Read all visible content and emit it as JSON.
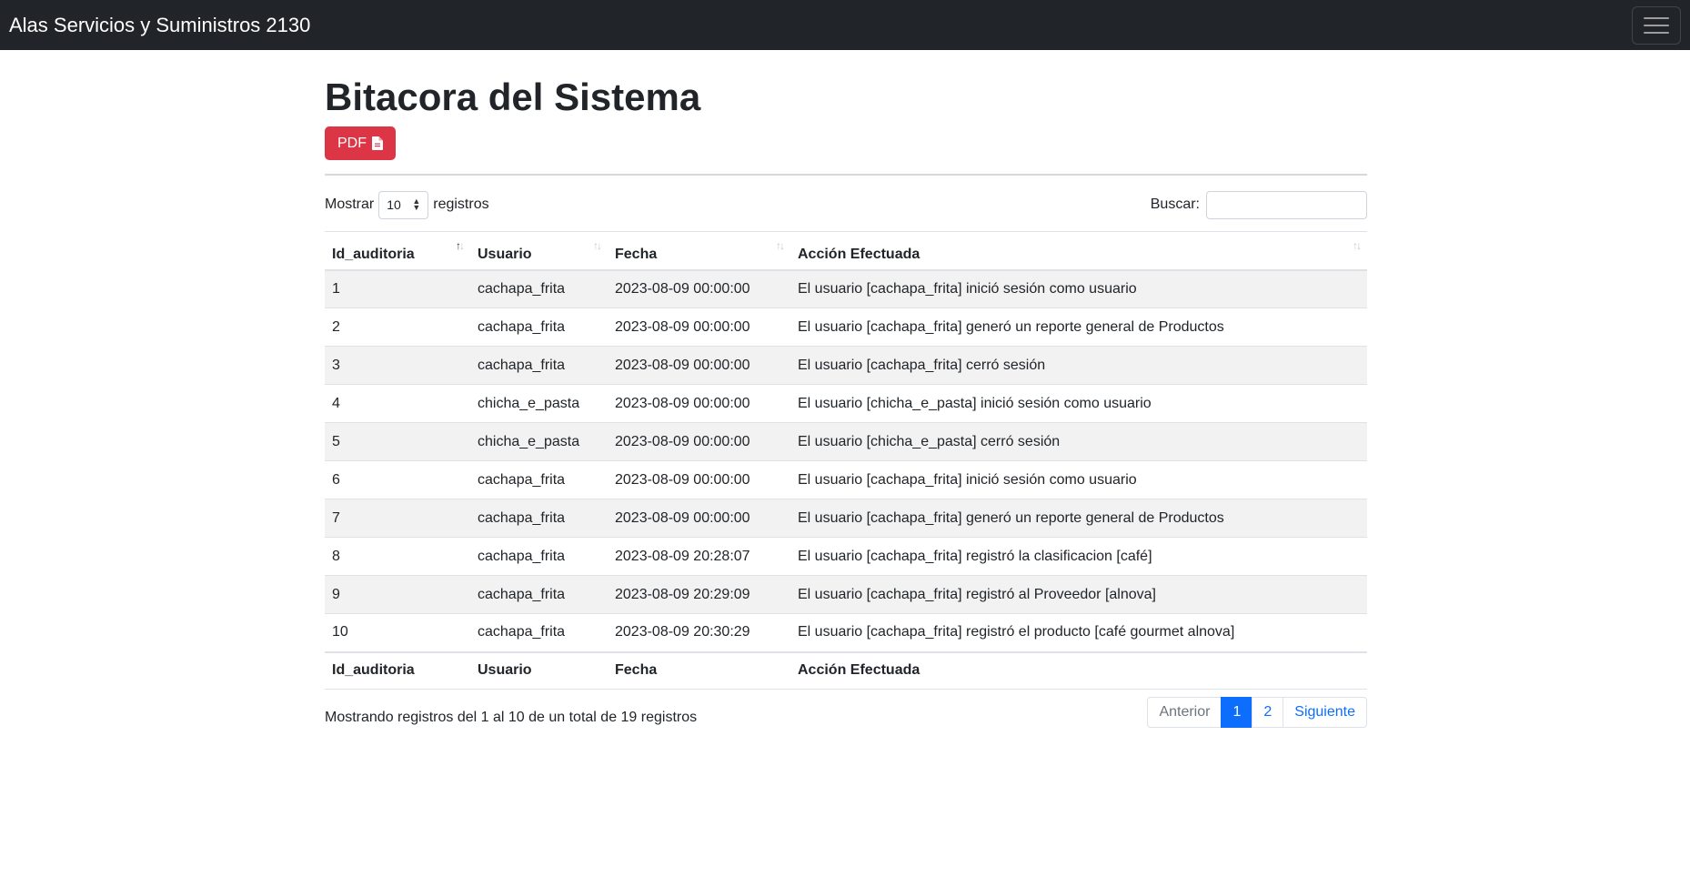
{
  "navbar": {
    "brand": "Alas Servicios y Suministros 2130",
    "toggler_icon": "hamburger-menu-icon"
  },
  "page": {
    "title": "Bitacora del Sistema",
    "pdf_button": "PDF",
    "pdf_icon": "file-icon"
  },
  "controls": {
    "show_label": "Mostrar",
    "length_value": "10",
    "records_label": "registros",
    "search_label": "Buscar:",
    "search_value": ""
  },
  "table": {
    "columns": [
      "Id_auditoria",
      "Usuario",
      "Fecha",
      "Acción Efectuada"
    ],
    "rows": [
      [
        "1",
        "cachapa_frita",
        "2023-08-09 00:00:00",
        "El usuario [cachapa_frita] inició sesión como usuario"
      ],
      [
        "2",
        "cachapa_frita",
        "2023-08-09 00:00:00",
        "El usuario [cachapa_frita] generó un reporte general de Productos"
      ],
      [
        "3",
        "cachapa_frita",
        "2023-08-09 00:00:00",
        "El usuario [cachapa_frita] cerró sesión"
      ],
      [
        "4",
        "chicha_e_pasta",
        "2023-08-09 00:00:00",
        "El usuario [chicha_e_pasta] inició sesión como usuario"
      ],
      [
        "5",
        "chicha_e_pasta",
        "2023-08-09 00:00:00",
        "El usuario [chicha_e_pasta] cerró sesión"
      ],
      [
        "6",
        "cachapa_frita",
        "2023-08-09 00:00:00",
        "El usuario [cachapa_frita] inició sesión como usuario"
      ],
      [
        "7",
        "cachapa_frita",
        "2023-08-09 00:00:00",
        "El usuario [cachapa_frita] generó un reporte general de Productos"
      ],
      [
        "8",
        "cachapa_frita",
        "2023-08-09 20:28:07",
        "El usuario [cachapa_frita] registró la clasificacion [café]"
      ],
      [
        "9",
        "cachapa_frita",
        "2023-08-09 20:29:09",
        "El usuario [cachapa_frita] registró al Proveedor [alnova]"
      ],
      [
        "10",
        "cachapa_frita",
        "2023-08-09 20:30:29",
        "El usuario [cachapa_frita] registró el producto [café gourmet alnova]"
      ]
    ]
  },
  "footer": {
    "info": "Mostrando registros del 1 al 10 de un total de 19 registros",
    "pagination": {
      "previous": "Anterior",
      "pages": [
        "1",
        "2"
      ],
      "next": "Siguiente"
    }
  },
  "colors": {
    "navbar_bg": "#212529",
    "danger": "#dc3545",
    "primary": "#0d6efd"
  }
}
